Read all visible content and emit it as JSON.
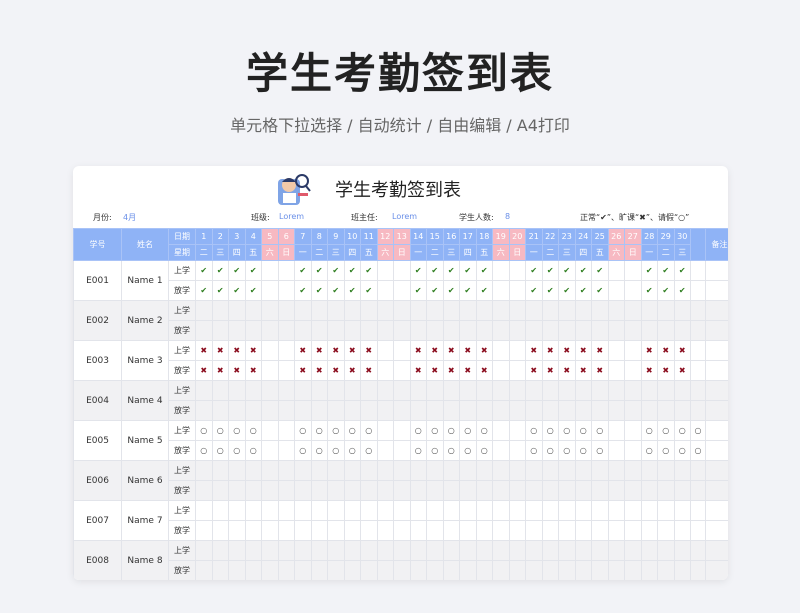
{
  "page": {
    "title": "学生考勤签到表",
    "subtitle": "单元格下拉选择 / 自动统计 / 自由编辑 / A4打印"
  },
  "sheet": {
    "title": "学生考勤签到表",
    "month_label": "月份:",
    "month_value": "4月",
    "class_label": "班级:",
    "class_value": "Lorem",
    "teacher_label": "班主任:",
    "teacher_value": "Lorem",
    "count_label": "学生人数:",
    "count_value": "8",
    "legend": "正常“✔”、旷课“✖”、请假“○”"
  },
  "table": {
    "col_id": "学号",
    "col_name": "姓名",
    "row_date": "日期",
    "row_weekday": "星期",
    "col_remark": "备注",
    "morning": "上学",
    "afternoon": "放学",
    "days": [
      "1",
      "2",
      "3",
      "4",
      "5",
      "6",
      "7",
      "8",
      "9",
      "10",
      "11",
      "12",
      "13",
      "14",
      "15",
      "16",
      "17",
      "18",
      "19",
      "20",
      "21",
      "22",
      "23",
      "24",
      "25",
      "26",
      "27",
      "28",
      "29",
      "30"
    ],
    "weekdays": [
      "二",
      "三",
      "四",
      "五",
      "六",
      "日",
      "一",
      "二",
      "三",
      "四",
      "五",
      "六",
      "日",
      "一",
      "二",
      "三",
      "四",
      "五",
      "六",
      "日",
      "一",
      "二",
      "三",
      "四",
      "五",
      "六",
      "日",
      "一",
      "二",
      "三"
    ],
    "weekend_columns": [
      5,
      6,
      12,
      13,
      19,
      20,
      26,
      27
    ],
    "marks": {
      "check": "✔",
      "cross": "✖",
      "circle": "○"
    },
    "students": [
      {
        "id": "E001",
        "name": "Name 1",
        "mark": "check",
        "days": [
          1,
          2,
          3,
          4,
          7,
          8,
          9,
          10,
          11,
          14,
          15,
          16,
          17,
          18,
          21,
          22,
          23,
          24,
          25,
          28,
          29,
          30
        ]
      },
      {
        "id": "E002",
        "name": "Name 2",
        "mark": "none",
        "days": []
      },
      {
        "id": "E003",
        "name": "Name 3",
        "mark": "cross",
        "days": [
          1,
          2,
          3,
          4,
          7,
          8,
          9,
          10,
          11,
          14,
          15,
          16,
          17,
          18,
          21,
          22,
          23,
          24,
          25,
          28,
          29,
          30
        ]
      },
      {
        "id": "E004",
        "name": "Name 4",
        "mark": "none",
        "days": []
      },
      {
        "id": "E005",
        "name": "Name 5",
        "mark": "circle",
        "days": [
          1,
          2,
          3,
          4,
          7,
          8,
          9,
          10,
          11,
          14,
          15,
          16,
          17,
          18,
          21,
          22,
          23,
          24,
          25,
          28,
          29,
          30,
          31
        ]
      },
      {
        "id": "E006",
        "name": "Name 6",
        "mark": "none",
        "days": []
      },
      {
        "id": "E007",
        "name": "Name 7",
        "mark": "none",
        "days": []
      },
      {
        "id": "E008",
        "name": "Name 8",
        "mark": "none",
        "days": []
      }
    ]
  }
}
